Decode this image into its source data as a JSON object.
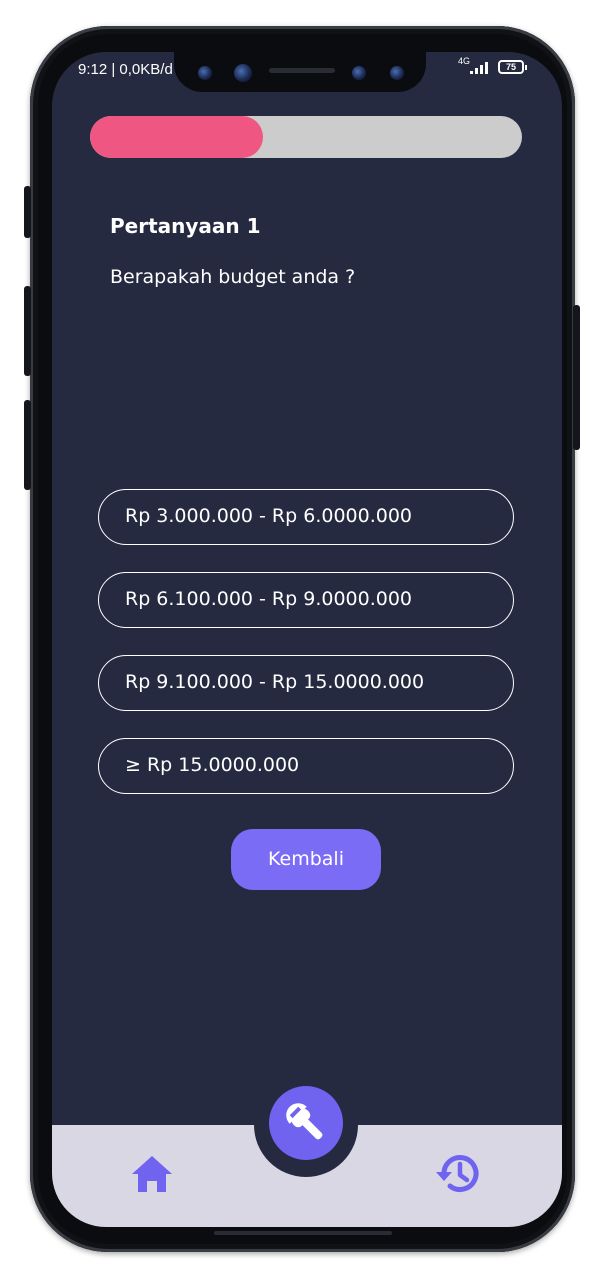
{
  "status_bar": {
    "time": "9:12 | 0,0KB/d",
    "network": "4G",
    "battery": "75"
  },
  "quiz": {
    "progress": 0.4,
    "question_title": "Pertanyaan 1",
    "question_text": "Berapakah budget anda ?",
    "options": [
      "Rp 3.000.000 - Rp 6.0000.000",
      "Rp 6.100.000 - Rp 9.0000.000",
      "Rp 9.100.000 - Rp 15.0000.000",
      "≥ Rp 15.0000.000"
    ],
    "back_label": "Kembali"
  },
  "nav": {
    "items": [
      "home-icon",
      "wrench-icon",
      "history-icon"
    ]
  },
  "colors": {
    "background": "#252a40",
    "progress_fill": "#ef5682",
    "progress_track": "#cccccc",
    "accent": "#7b6cf6",
    "nav_bar": "#d9d7e4"
  }
}
